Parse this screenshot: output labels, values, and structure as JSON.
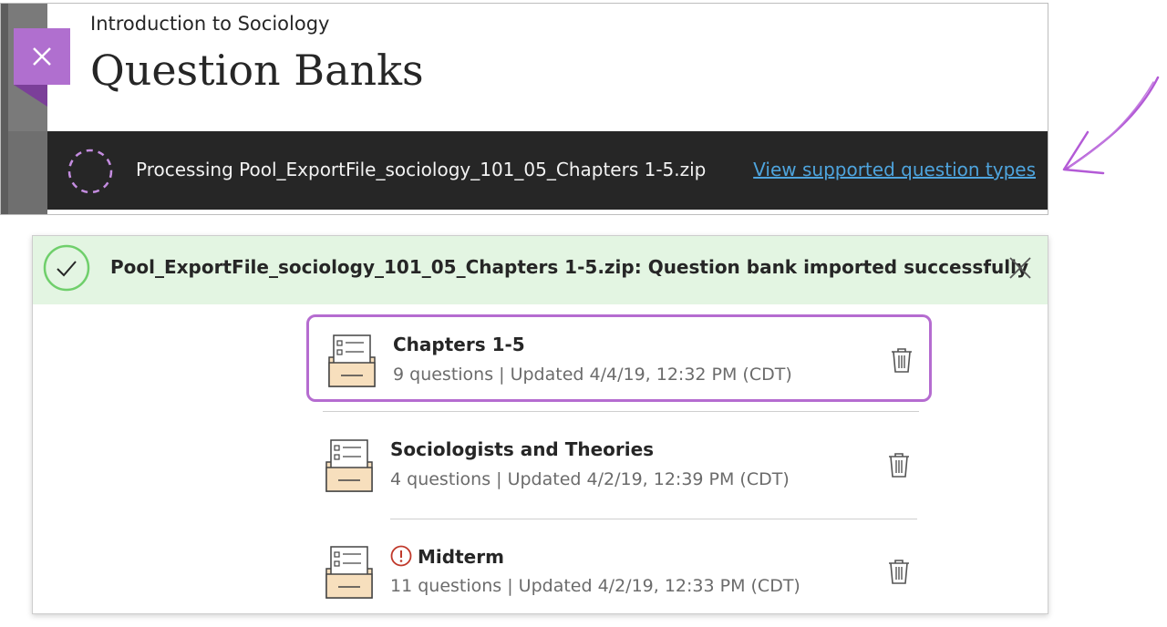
{
  "header": {
    "course_name": "Introduction to Sociology",
    "page_title": "Question Banks"
  },
  "processing": {
    "message": "Processing Pool_ExportFile_sociology_101_05_Chapters 1-5.zip",
    "link_label": "View supported question types"
  },
  "success_banner": {
    "message": "Pool_ExportFile_sociology_101_05_Chapters 1-5.zip: Question bank imported successfully"
  },
  "question_banks": [
    {
      "title": "Chapters 1-5",
      "meta": "9 questions | Updated 4/4/19, 12:32 PM (CDT)",
      "warning": false,
      "highlighted": true
    },
    {
      "title": "Sociologists and Theories",
      "meta": "4 questions | Updated 4/2/19, 12:39 PM (CDT)",
      "warning": false,
      "highlighted": false
    },
    {
      "title": "Midterm",
      "meta": "11 questions | Updated 4/2/19, 12:33 PM (CDT)",
      "warning": true,
      "highlighted": false
    }
  ],
  "icons": {
    "close_panel": "close-icon",
    "spinner": "spinner-icon",
    "success": "checkmark-icon",
    "banner_close": "close-icon",
    "bank": "question-bank-icon",
    "delete": "trash-icon",
    "warning": "warning-icon"
  },
  "colors": {
    "accent_purple": "#b06fcf",
    "processing_bar": "#262626",
    "link_blue": "#4ea4dd",
    "success_bg": "#e3f5e2",
    "success_green": "#6fcf6b",
    "warning_red": "#c0392b"
  }
}
